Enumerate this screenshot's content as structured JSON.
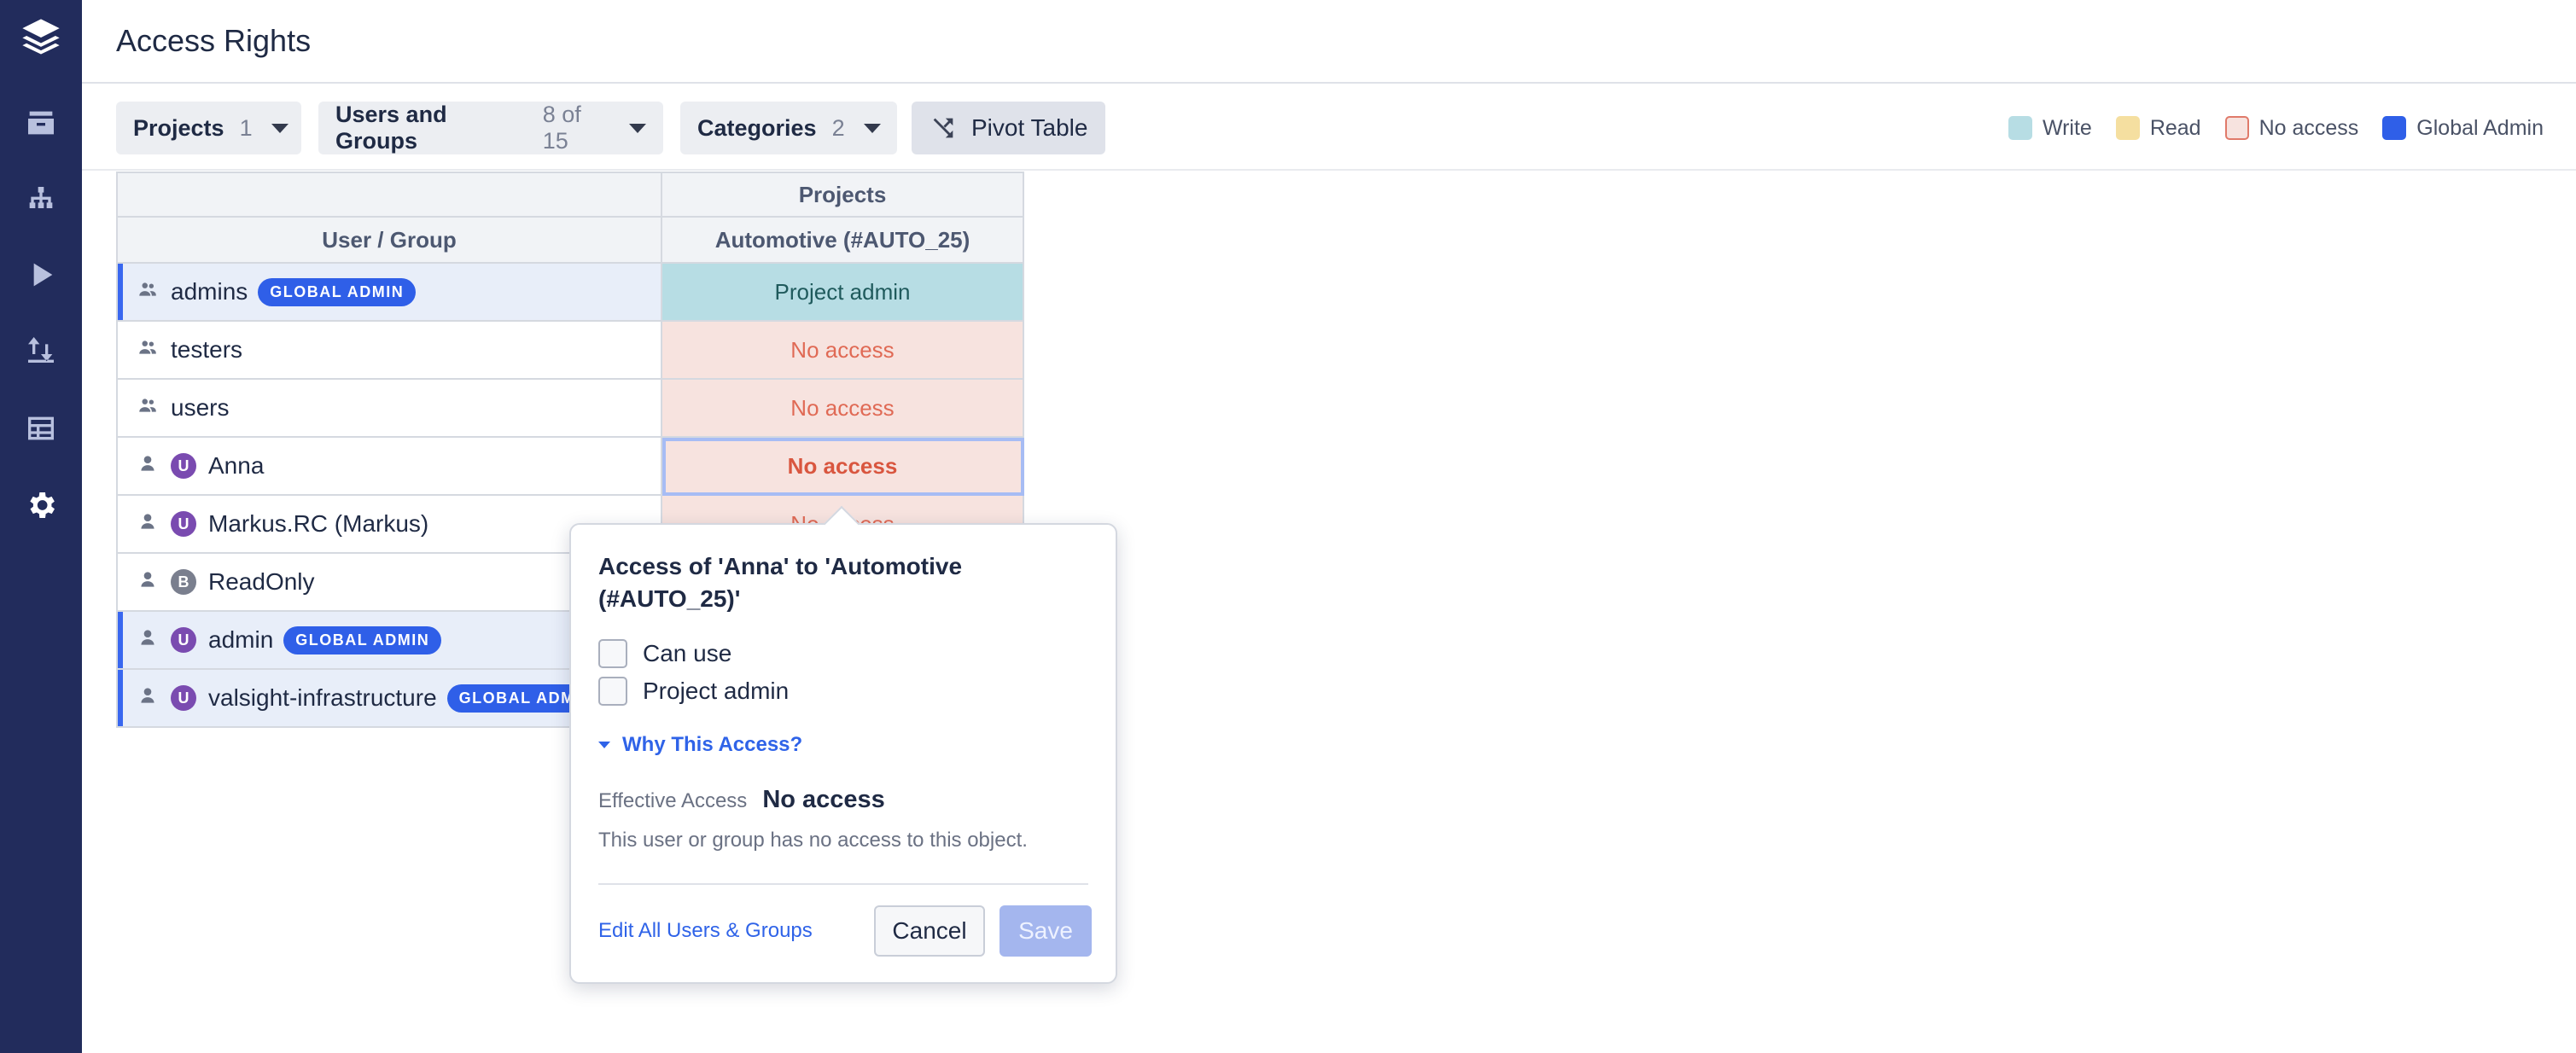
{
  "header": {
    "title": "Access Rights"
  },
  "sidebar": {
    "items": [
      {
        "icon": "layers-logo-icon"
      },
      {
        "icon": "archive-icon"
      },
      {
        "icon": "hierarchy-icon"
      },
      {
        "icon": "play-icon"
      },
      {
        "icon": "transfer-icon"
      },
      {
        "icon": "table-icon"
      },
      {
        "icon": "gear-icon"
      }
    ]
  },
  "toolbar": {
    "filters": [
      {
        "label": "Projects",
        "count": "1"
      },
      {
        "label": "Users and Groups",
        "count": "8 of 15"
      },
      {
        "label": "Categories",
        "count": "2"
      }
    ],
    "pivot_label": "Pivot Table"
  },
  "legend": [
    {
      "label": "Write",
      "color": "#b7dde4",
      "border": "#b7dde4"
    },
    {
      "label": "Read",
      "color": "#f5dfa0",
      "border": "#f5dfa0"
    },
    {
      "label": "No access",
      "color": "#f7e3df",
      "border": "#e07a6a"
    },
    {
      "label": "Global Admin",
      "color": "#2f5fe8",
      "border": "#2f5fe8"
    }
  ],
  "table": {
    "group_header": "Projects",
    "col_user": "User / Group",
    "col_project": "Automotive (#AUTO_25)",
    "rows": [
      {
        "type": "group",
        "name": "admins",
        "badge": "GLOBAL ADMIN",
        "access": "Project admin"
      },
      {
        "type": "group",
        "name": "testers",
        "badge": "",
        "access": "No access"
      },
      {
        "type": "group",
        "name": "users",
        "badge": "",
        "access": "No access"
      },
      {
        "type": "user",
        "avatar": "U",
        "name": "Anna",
        "badge": "",
        "access": "No access"
      },
      {
        "type": "user",
        "avatar": "U",
        "name": "Markus.RC (Markus)",
        "badge": "",
        "access": "No access"
      },
      {
        "type": "user",
        "avatar": "B",
        "name": "ReadOnly",
        "badge": "",
        "access": ""
      },
      {
        "type": "user",
        "avatar": "U",
        "name": "admin",
        "badge": "GLOBAL ADMIN",
        "access": ""
      },
      {
        "type": "user",
        "avatar": "U",
        "name": "valsight-infrastructure",
        "badge": "GLOBAL ADMIN",
        "access": ""
      }
    ]
  },
  "popover": {
    "title": "Access of 'Anna' to 'Automotive (#AUTO_25)'",
    "options": [
      "Can use",
      "Project admin"
    ],
    "why_label": "Why This Access?",
    "effective_label": "Effective Access",
    "effective_value": "No access",
    "description": "This user or group has no access to this object.",
    "edit_link": "Edit All Users & Groups",
    "cancel_label": "Cancel",
    "save_label": "Save"
  }
}
